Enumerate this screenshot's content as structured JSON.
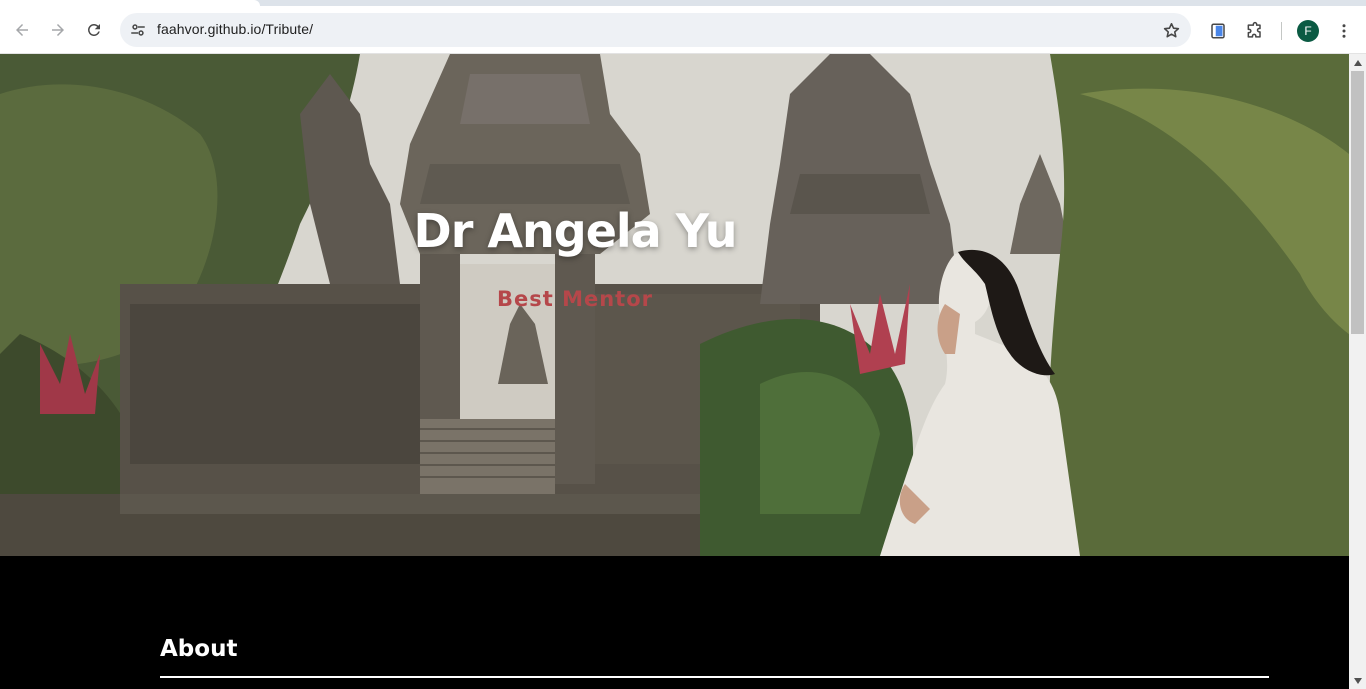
{
  "browser": {
    "url": "faahvor.github.io/Tribute/",
    "profile_initial": "F",
    "icons": {
      "back": "arrow-left-icon",
      "forward": "arrow-right-icon",
      "reload": "reload-icon",
      "site_info": "tune-icon",
      "bookmark": "star-outline-icon",
      "extension_1": "side-panel-icon",
      "extension_2": "puzzle-piece-icon",
      "menu": "kebab-menu-icon"
    },
    "colors": {
      "avatar": "#0b5a43",
      "omnibox": "#eef1f5"
    }
  },
  "hero": {
    "title": "Dr Angela Yu",
    "subtitle": "Best Mentor",
    "colors": {
      "title": "#ffffff",
      "subtitle": "#b5474a"
    }
  },
  "about": {
    "heading": "About"
  }
}
